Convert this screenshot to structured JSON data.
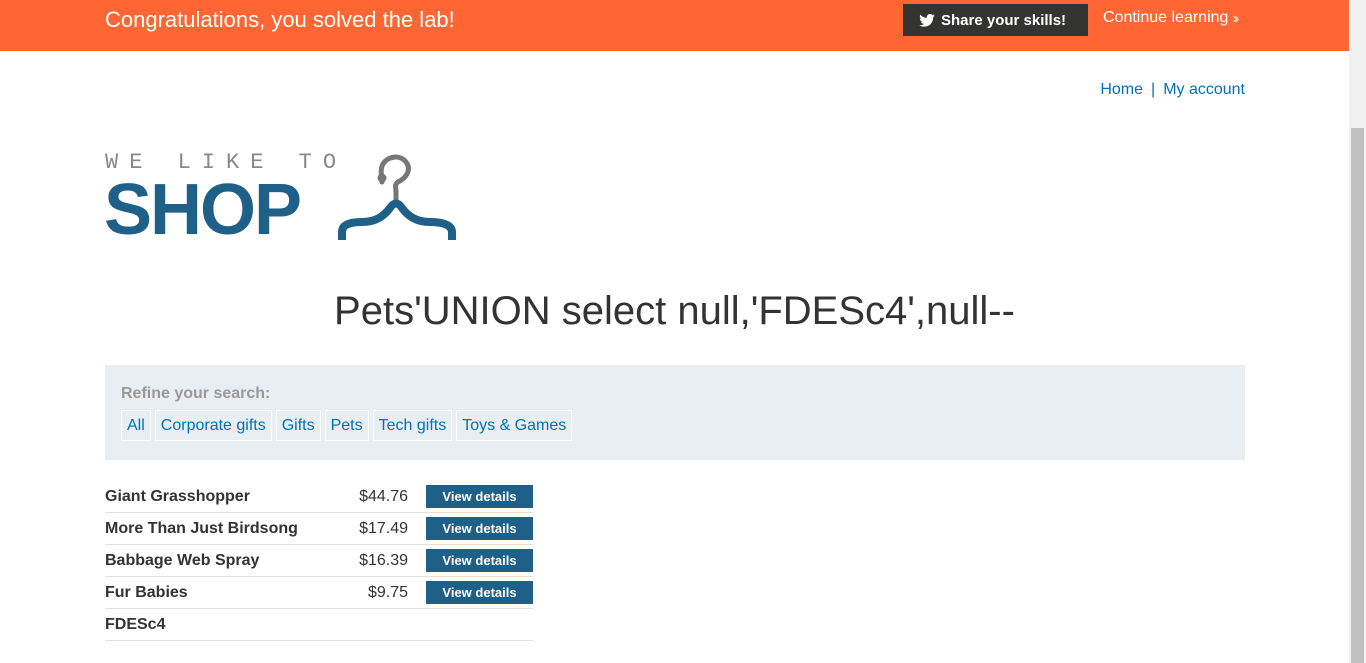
{
  "banner": {
    "title": "Congratulations, you solved the lab!",
    "share_label": "Share your skills!",
    "continue_label": "Continue learning",
    "twitter_icon": "twitter-icon",
    "continue_icon": "double-chevron-right-icon",
    "color": "#ff6633"
  },
  "nav": {
    "home": "Home",
    "separator": "|",
    "account": "My account"
  },
  "logo": {
    "small": "WE LIKE TO",
    "big": "SHOP",
    "icon": "hanger-icon",
    "color": "#1e6087"
  },
  "heading": "Pets'UNION select null,'FDESc4',null--",
  "filters": {
    "label": "Refine your search:",
    "items": [
      "All",
      "Corporate gifts",
      "Gifts",
      "Pets",
      "Tech gifts",
      "Toys & Games"
    ]
  },
  "products": [
    {
      "name": "Giant Grasshopper",
      "price": "$44.76",
      "action": "View details"
    },
    {
      "name": "More Than Just Birdsong",
      "price": "$17.49",
      "action": "View details"
    },
    {
      "name": "Babbage Web Spray",
      "price": "$16.39",
      "action": "View details"
    },
    {
      "name": "Fur Babies",
      "price": "$9.75",
      "action": "View details"
    },
    {
      "name": "FDESc4",
      "price": "",
      "action": ""
    }
  ]
}
